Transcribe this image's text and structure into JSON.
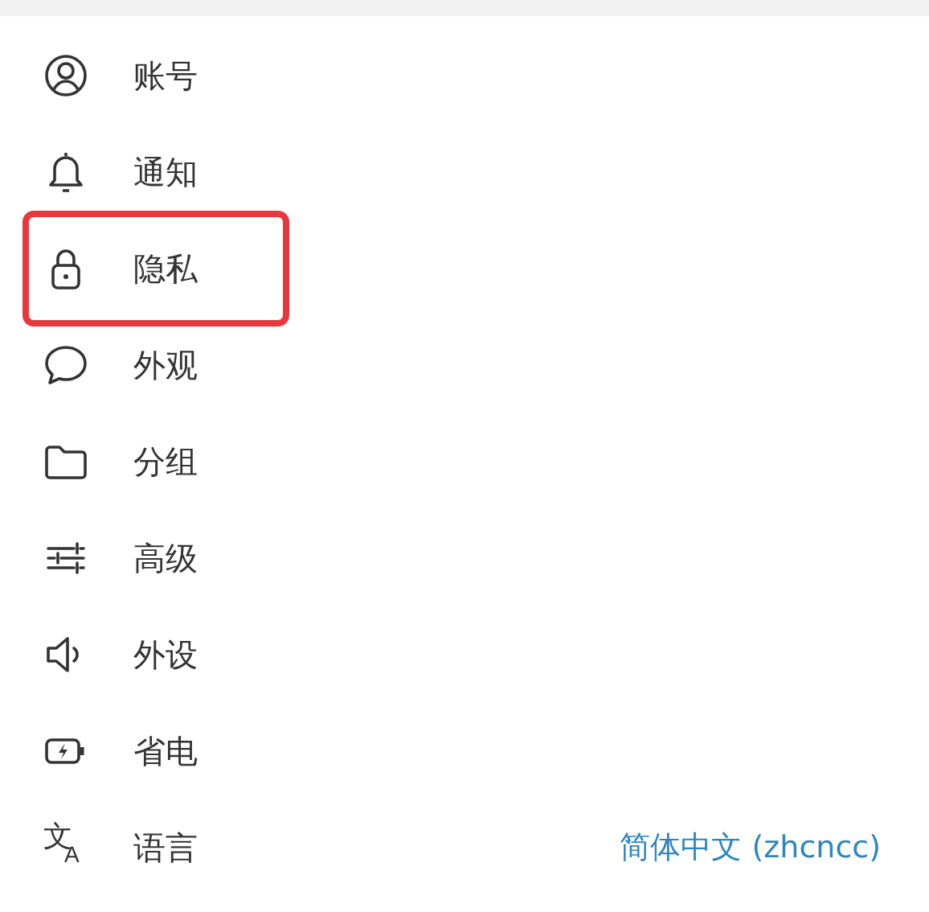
{
  "settings_menu": {
    "items": [
      {
        "label": "账号",
        "highlighted": false
      },
      {
        "label": "通知",
        "highlighted": false
      },
      {
        "label": "隐私",
        "highlighted": true
      },
      {
        "label": "外观",
        "highlighted": false
      },
      {
        "label": "分组",
        "highlighted": false
      },
      {
        "label": "高级",
        "highlighted": false
      },
      {
        "label": "外设",
        "highlighted": false
      },
      {
        "label": "省电",
        "highlighted": false
      },
      {
        "icon_glyphs": [
          "文",
          "A"
        ],
        "label": "语言",
        "highlighted": false,
        "value": "简体中文 (zhcncc)"
      }
    ]
  }
}
